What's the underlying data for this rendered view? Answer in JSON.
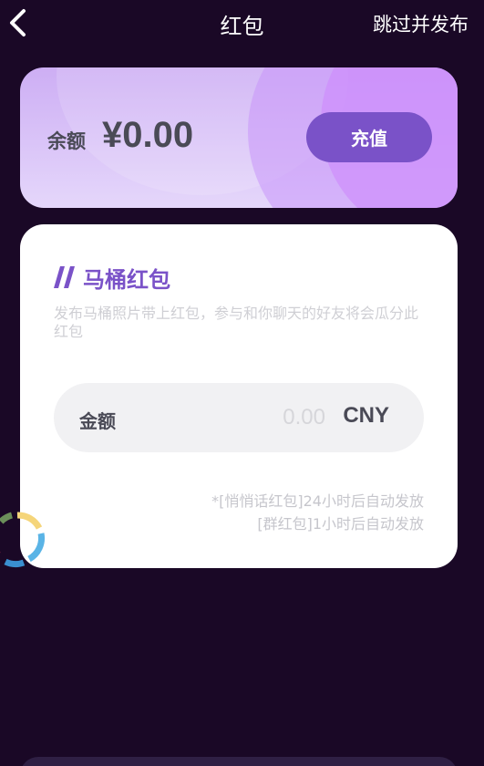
{
  "header": {
    "title": "红包",
    "skip_label": "跳过并发布"
  },
  "balance": {
    "label": "余额",
    "value": "¥0.00",
    "recharge_label": "充值"
  },
  "card": {
    "title": "马桶红包",
    "description": "发布马桶照片带上红包，参与和你聊天的好友将会瓜分此红包",
    "amount_label": "金额",
    "amount_placeholder": "0.00",
    "currency": "CNY",
    "notes": [
      "*[悄悄话红包]24小时后自动发放",
      "[群红包]1小时后自动发放"
    ]
  },
  "colors": {
    "background": "#1a0826",
    "accent": "#7a52c8",
    "card": "#ffffff"
  },
  "icons": [
    "back-arrow-icon",
    "double-slash-icon",
    "loading-spinner-icon"
  ]
}
